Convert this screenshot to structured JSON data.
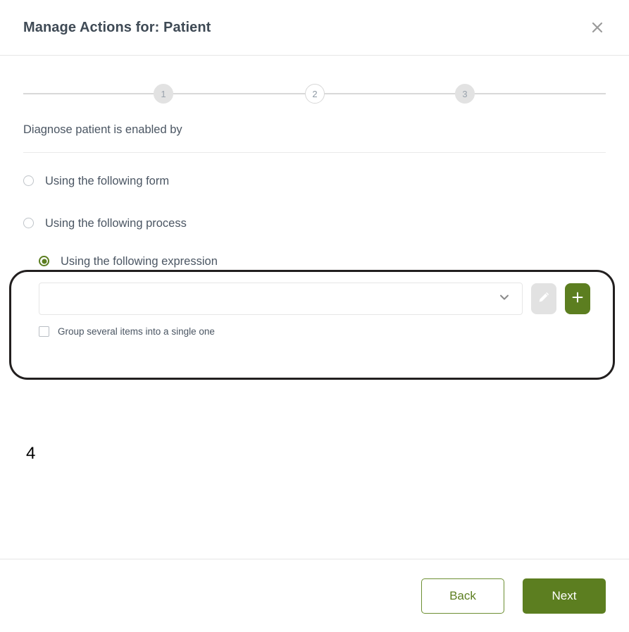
{
  "header": {
    "title": "Manage Actions for: Patient",
    "close_icon": "close-icon"
  },
  "stepper": {
    "steps": [
      {
        "label": "1",
        "state": "done"
      },
      {
        "label": "2",
        "state": "current"
      },
      {
        "label": "3",
        "state": "done"
      }
    ]
  },
  "main": {
    "section_label": "Diagnose patient is enabled by",
    "options": [
      {
        "label": "Using the following form",
        "selected": false
      },
      {
        "label": "Using the following process",
        "selected": false
      },
      {
        "label": "Using the following expression",
        "selected": true
      }
    ],
    "expression": {
      "select_value": "",
      "select_placeholder": "",
      "chevron_icon": "chevron-down-icon",
      "edit_icon": "pencil-icon",
      "edit_disabled": true,
      "add_icon": "plus-icon",
      "group_checkbox_label": "Group several items into a single one",
      "group_checkbox_checked": false
    }
  },
  "annotation": {
    "step_number": "4"
  },
  "footer": {
    "back_label": "Back",
    "next_label": "Next"
  },
  "colors": {
    "brand_green": "#5c7e20",
    "title_text": "#3f4a55",
    "body_text": "#4b5663",
    "border_light": "#e6e6e6",
    "disabled_gray": "#e2e2e2",
    "highlight_outline": "#221f1f"
  }
}
